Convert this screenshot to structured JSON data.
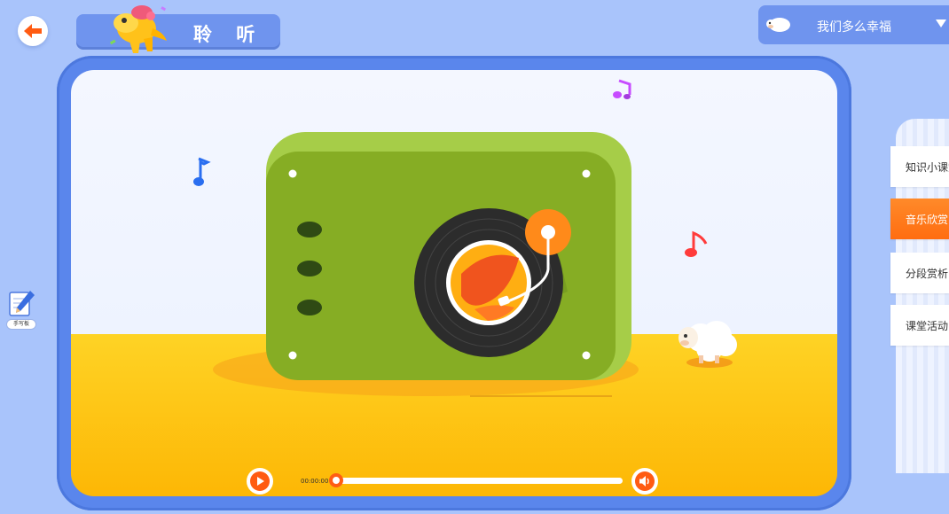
{
  "header": {
    "title": "聆 听",
    "song_selector": {
      "selected": "我们多么幸福"
    }
  },
  "player": {
    "time": "00:00:00",
    "progress": 0
  },
  "tools": {
    "handwriting_label": "手写板"
  },
  "sidebar": {
    "items": [
      {
        "label": "知识小课堂",
        "active": false
      },
      {
        "label": "音乐欣赏",
        "active": true
      },
      {
        "label": "分段赏析",
        "active": false
      },
      {
        "label": "课堂活动",
        "active": false
      }
    ]
  },
  "icons": [
    "back-arrow-icon",
    "dinosaur-mascot-icon",
    "sheep-icon",
    "chevron-down-icon",
    "play-icon",
    "volume-icon",
    "pencil-pad-icon",
    "music-note-icon"
  ],
  "colors": {
    "accent": "#ff6d10",
    "frame": "#5a86ec",
    "background": "#a9c4fb",
    "record_player": "#8ab52a"
  }
}
